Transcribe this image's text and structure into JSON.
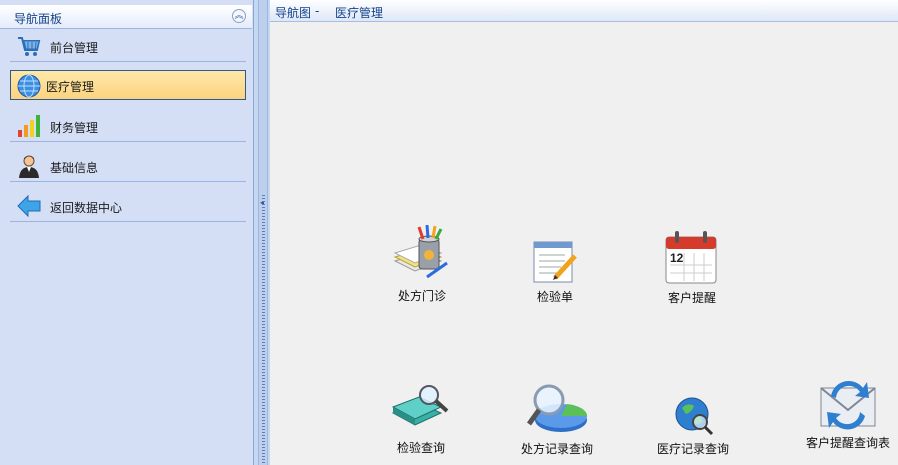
{
  "nav": {
    "title": "导航面板",
    "collapse_symbol": "︽",
    "items": [
      {
        "label": "前台管理",
        "icon": "shopping-cart-icon"
      },
      {
        "label": "医疗管理",
        "icon": "globe-icon",
        "active": true
      },
      {
        "label": "财务管理",
        "icon": "bar-chart-icon"
      },
      {
        "label": "基础信息",
        "icon": "user-icon"
      },
      {
        "label": "返回数据中心",
        "icon": "back-arrow-icon"
      }
    ]
  },
  "breadcrumb": {
    "root": "导航图",
    "separator": "-",
    "current": "医疗管理"
  },
  "tiles": [
    {
      "label": "处方门诊",
      "icon": "prescription-icon"
    },
    {
      "label": "检验单",
      "icon": "form-edit-icon"
    },
    {
      "label": "客户提醒",
      "icon": "calendar-icon",
      "calendar_day": "12"
    },
    {
      "label": "检验查询",
      "icon": "book-search-icon"
    },
    {
      "label": "处方记录查询",
      "icon": "pie-search-icon"
    },
    {
      "label": "医疗记录查询",
      "icon": "globe-search-icon"
    },
    {
      "label": "客户提醒查询表",
      "icon": "mail-refresh-icon"
    }
  ],
  "colors": {
    "nav_bg": "#d4dff6",
    "header_text": "#15428b",
    "active_item": "#fbd37f",
    "content_bg": "#f0f0f0"
  }
}
